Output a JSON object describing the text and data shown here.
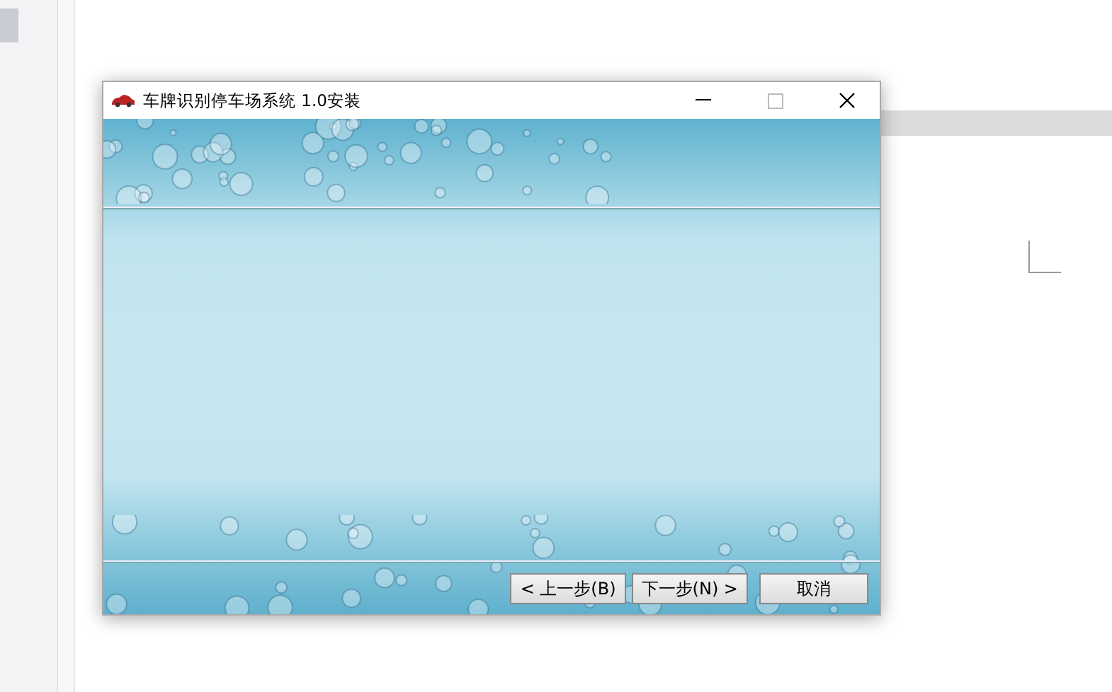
{
  "window": {
    "title": "车牌识别停车场系统 1.0安装"
  },
  "buttons": [
    {
      "label": "< 上一步(B)",
      "kind": "back"
    },
    {
      "label": "下一步(N) >",
      "kind": "next"
    },
    {
      "label": "取消",
      "kind": "cancel"
    }
  ]
}
